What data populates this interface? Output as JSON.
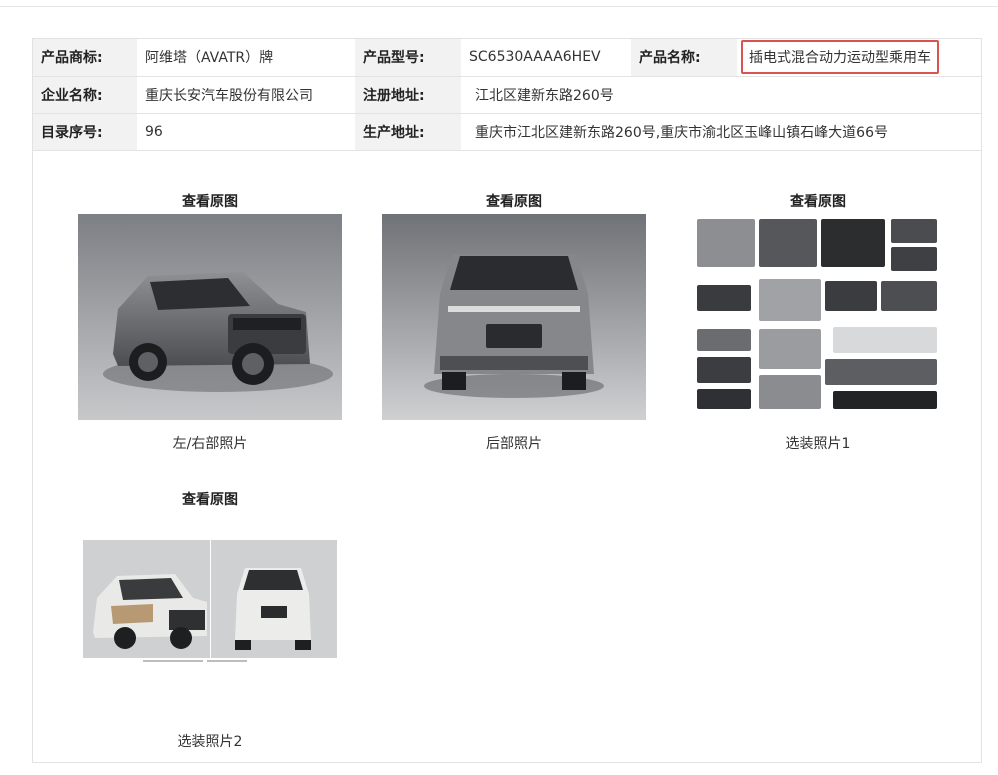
{
  "info": {
    "row1": {
      "brand_label": "产品商标:",
      "brand_value": "阿维塔（AVATR）牌",
      "model_label": "产品型号:",
      "model_value": "SC6530AAAA6HEV",
      "name_label": "产品名称:",
      "name_value": "插电式混合动力运动型乘用车"
    },
    "row2": {
      "company_label": "企业名称:",
      "company_value": "重庆长安汽车股份有限公司",
      "reg_addr_label": "注册地址:",
      "reg_addr_value": "江北区建新东路260号"
    },
    "row3": {
      "catalog_label": "目录序号:",
      "catalog_value": "96",
      "prod_addr_label": "生产地址:",
      "prod_addr_value": "重庆市江北区建新东路260号,重庆市渝北区玉峰山镇石峰大道66号"
    }
  },
  "photos": [
    {
      "view_label": "查看原图",
      "caption": "左/右部照片"
    },
    {
      "view_label": "查看原图",
      "caption": "后部照片"
    },
    {
      "view_label": "查看原图",
      "caption": "选装照片1"
    },
    {
      "view_label": "查看原图",
      "caption": "选装照片2"
    }
  ],
  "colors": {
    "highlight_border": "#d9534f",
    "label_bg": "#f2f2f2",
    "border": "#e2e2e2"
  }
}
